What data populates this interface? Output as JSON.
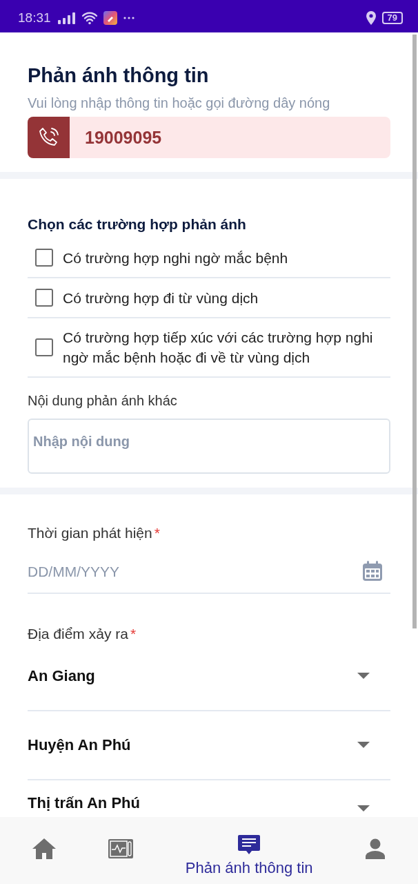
{
  "status_bar": {
    "time": "18:31",
    "battery": "79"
  },
  "header": {
    "title": "Phản ánh thông tin",
    "subtitle": "Vui lòng nhập thông tin hoặc gọi đường dây nóng",
    "hotline": "19009095"
  },
  "cases": {
    "heading": "Chọn các trường hợp phản ánh",
    "options": [
      {
        "label": "Có trường hợp nghi ngờ mắc bệnh",
        "checked": false
      },
      {
        "label": "Có trường hợp đi từ vùng dịch",
        "checked": false
      },
      {
        "label": "Có trường hợp tiếp xúc với các trường hợp nghi ngờ mắc bệnh hoặc đi về từ vùng dịch",
        "checked": false
      }
    ],
    "other_label": "Nội dung phản ánh khác",
    "other_placeholder": "Nhập nội dung"
  },
  "time": {
    "label": "Thời gian phát hiện",
    "required": "*",
    "placeholder": "DD/MM/YYYY"
  },
  "location": {
    "label": "Địa điểm xảy ra",
    "required": "*",
    "dropdowns": [
      "An Giang",
      "Huyện An Phú",
      "Thị trấn An Phú"
    ]
  },
  "bottom_nav": [
    {
      "kind": "home",
      "selected": false
    },
    {
      "kind": "monitor",
      "selected": false
    },
    {
      "kind": "feedback",
      "selected": true,
      "label": "Phản ánh thông tin"
    },
    {
      "kind": "profile",
      "selected": false
    }
  ]
}
